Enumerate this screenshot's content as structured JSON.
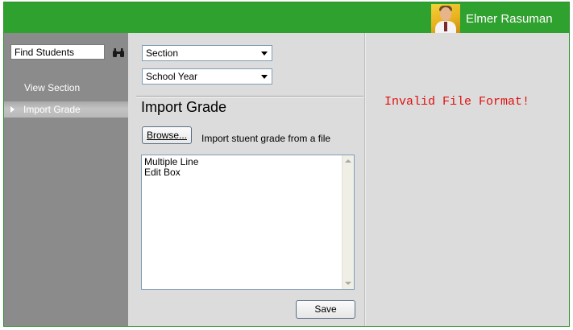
{
  "header": {
    "user_name": "Elmer Rasuman",
    "avatar": "user-avatar-photo",
    "accent_color": "#2ea12e"
  },
  "sidebar": {
    "search": {
      "value": "Find Students",
      "icon": "binoculars-icon"
    },
    "items": [
      {
        "label": "View Section",
        "selected": false
      },
      {
        "label": "Import Grade",
        "selected": true
      }
    ]
  },
  "main": {
    "section_select": {
      "value": "Section"
    },
    "school_year_select": {
      "value": "School Year"
    },
    "title": "Import Grade",
    "browse_label": "Browse...",
    "browse_hint": "Import stuent grade from a file",
    "textarea_value": "Multiple Line\nEdit Box",
    "save_label": "Save"
  },
  "status": {
    "message": "Invalid File Format!",
    "color": "#e01010"
  }
}
